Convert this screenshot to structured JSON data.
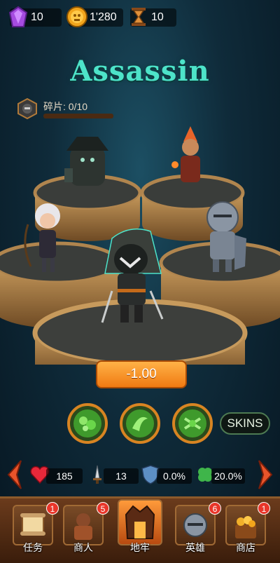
{
  "currencies": {
    "gems": "10",
    "coins": "1'280",
    "tokens": "10"
  },
  "hero": {
    "name": "Assassin",
    "shards_label": "碎片: 0/10",
    "shards_progress": 0.0
  },
  "price_label": "-1.00",
  "skins_label": "SKINS",
  "stats": {
    "health": "185",
    "attack": "13",
    "defense": "0.0%",
    "luck": "20.0%"
  },
  "nav": {
    "quests": {
      "label": "任务",
      "badge": "1"
    },
    "merchant": {
      "label": "商人",
      "badge": "5"
    },
    "dungeon": {
      "label": "地牢"
    },
    "heroes": {
      "label": "英雄",
      "badge": "6"
    },
    "shop": {
      "label": "商店",
      "badge": "1"
    }
  },
  "colors": {
    "title": "#4de3c9",
    "price_button": "#f07a12",
    "badge": "#e9362a",
    "skill_glow": "#5fd35a"
  }
}
